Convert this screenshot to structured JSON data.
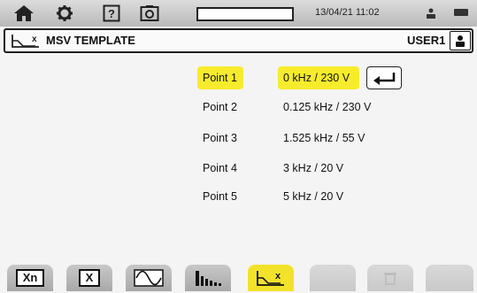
{
  "status_bar": {
    "datetime": "13/04/21 11:02",
    "icons": [
      "home-icon",
      "settings-icon",
      "help-icon",
      "camera-icon",
      "person-icon",
      "battery-icon"
    ]
  },
  "header": {
    "title": "MSV TEMPLATE",
    "user": "USER1",
    "icon": "msv-template-icon"
  },
  "points": [
    {
      "label": "Point 1",
      "value": "0 kHz / 230 V",
      "selected": true
    },
    {
      "label": "Point 2",
      "value": "0.125 kHz / 230 V",
      "selected": false
    },
    {
      "label": "Point 3",
      "value": "1.525 kHz / 55 V",
      "selected": false
    },
    {
      "label": "Point 4",
      "value": "3 kHz / 20 V",
      "selected": false
    },
    {
      "label": "Point 5",
      "value": "5 kHz / 20 V",
      "selected": false
    }
  ],
  "enter_button": {
    "icon": "enter-icon"
  },
  "function_keys": [
    {
      "label": "Xn",
      "icon": "xn-icon",
      "active": false
    },
    {
      "label": "X",
      "icon": "x-icon",
      "active": false
    },
    {
      "label": "",
      "icon": "sine-wave-icon",
      "active": false
    },
    {
      "label": "",
      "icon": "harmonics-bars-icon",
      "active": false
    },
    {
      "label": "",
      "icon": "msv-template-icon",
      "active": true
    },
    {
      "label": "",
      "icon": "blank-key",
      "active": false
    },
    {
      "label": "",
      "icon": "trash-icon",
      "active": false
    },
    {
      "label": "",
      "icon": "blank-key",
      "active": false
    }
  ],
  "colors": {
    "highlight": "#f7ec2c",
    "active_key": "#f2e22a",
    "key": "#b5b5b5",
    "background": "#f4f4f4"
  }
}
